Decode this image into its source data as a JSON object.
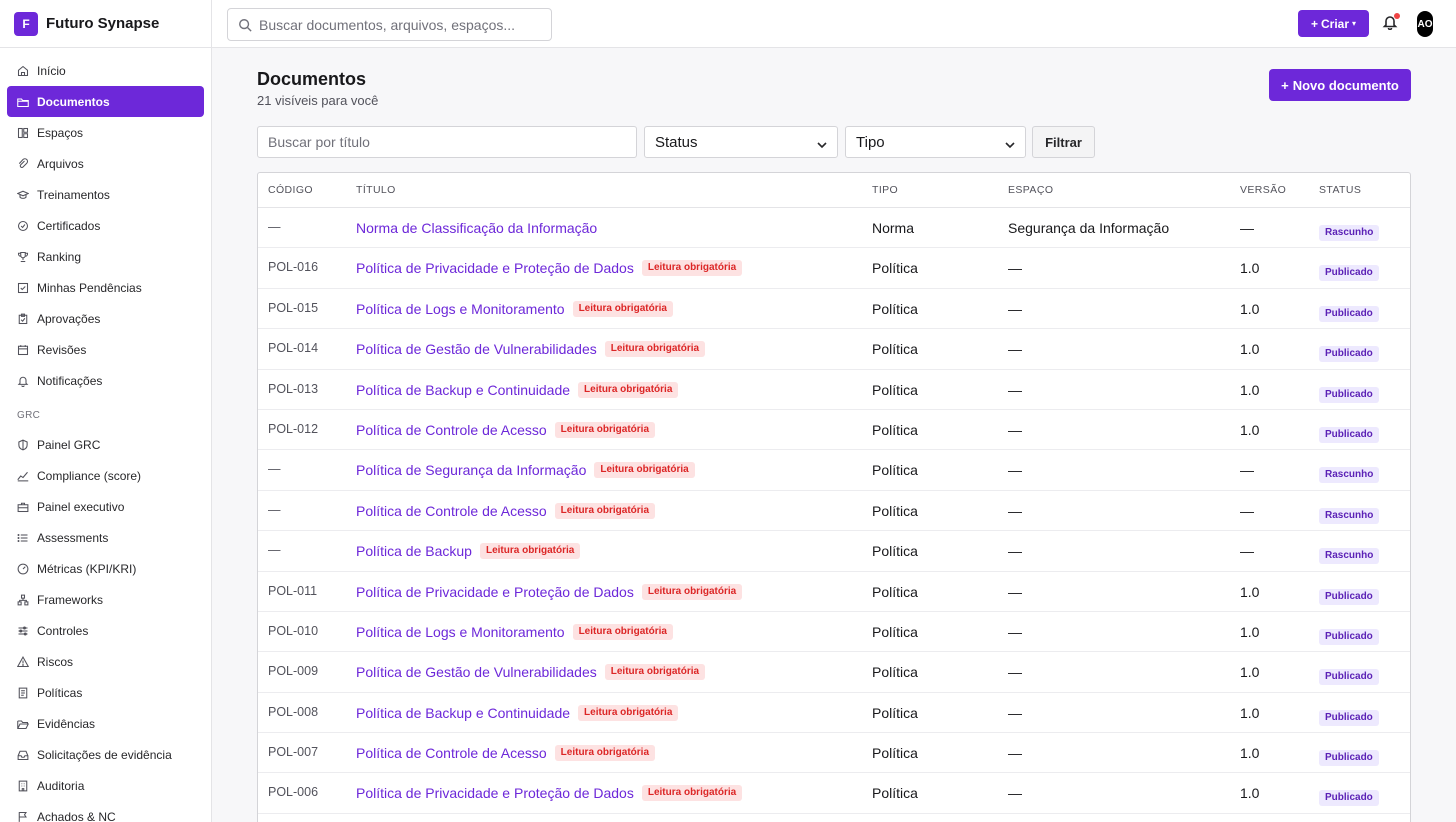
{
  "brand": {
    "logo_letter": "F",
    "name": "Futuro Synapse"
  },
  "sidebar": {
    "items": [
      {
        "label": "Início",
        "icon": "home-icon"
      },
      {
        "label": "Documentos",
        "icon": "folder-icon",
        "active": true
      },
      {
        "label": "Espaços",
        "icon": "spaces-icon"
      },
      {
        "label": "Arquivos",
        "icon": "paperclip-icon"
      },
      {
        "label": "Treinamentos",
        "icon": "graduation-icon"
      },
      {
        "label": "Certificados",
        "icon": "badge-check-icon"
      },
      {
        "label": "Ranking",
        "icon": "trophy-icon"
      },
      {
        "label": "Minhas Pendências",
        "icon": "check-square-icon"
      },
      {
        "label": "Aprovações",
        "icon": "clipboard-check-icon"
      },
      {
        "label": "Revisões",
        "icon": "calendar-icon"
      },
      {
        "label": "Notificações",
        "icon": "bell-icon"
      }
    ],
    "section_label": "GRC",
    "grc_items": [
      {
        "label": "Painel GRC",
        "icon": "shield-icon"
      },
      {
        "label": "Compliance (score)",
        "icon": "trend-icon"
      },
      {
        "label": "Painel executivo",
        "icon": "briefcase-icon"
      },
      {
        "label": "Assessments",
        "icon": "list-icon"
      },
      {
        "label": "Métricas (KPI/KRI)",
        "icon": "gauge-icon"
      },
      {
        "label": "Frameworks",
        "icon": "network-icon"
      },
      {
        "label": "Controles",
        "icon": "sliders-icon"
      },
      {
        "label": "Riscos",
        "icon": "warning-icon"
      },
      {
        "label": "Políticas",
        "icon": "document-icon"
      },
      {
        "label": "Evidências",
        "icon": "folder-open-icon"
      },
      {
        "label": "Solicitações de evidência",
        "icon": "inbox-icon"
      },
      {
        "label": "Auditoria",
        "icon": "building-icon"
      },
      {
        "label": "Achados & NC",
        "icon": "flag-icon"
      }
    ]
  },
  "topbar": {
    "search_placeholder": "Buscar documentos, arquivos, espaços...",
    "create_label": "Criar",
    "avatar_initials": "AO"
  },
  "page": {
    "title": "Documentos",
    "subtitle": "21 visíveis para você",
    "new_button": "Novo documento"
  },
  "filters": {
    "title_placeholder": "Buscar por título",
    "status_selected": "Status",
    "tipo_selected": "Tipo",
    "filter_button": "Filtrar"
  },
  "table": {
    "columns": [
      "CÓDIGO",
      "TÍTULO",
      "TIPO",
      "ESPAÇO",
      "VERSÃO",
      "STATUS"
    ],
    "required_badge": "Leitura obrigatória",
    "rows": [
      {
        "code": "—",
        "title": "Norma de Classificação da Informação",
        "required": false,
        "tipo": "Norma",
        "espaco": "Segurança da Informação",
        "versao": "—",
        "status": "Rascunho"
      },
      {
        "code": "POL-016",
        "title": "Política de Privacidade e Proteção de Dados",
        "required": true,
        "tipo": "Política",
        "espaco": "—",
        "versao": "1.0",
        "status": "Publicado"
      },
      {
        "code": "POL-015",
        "title": "Política de Logs e Monitoramento",
        "required": true,
        "tipo": "Política",
        "espaco": "—",
        "versao": "1.0",
        "status": "Publicado"
      },
      {
        "code": "POL-014",
        "title": "Política de Gestão de Vulnerabilidades",
        "required": true,
        "tipo": "Política",
        "espaco": "—",
        "versao": "1.0",
        "status": "Publicado"
      },
      {
        "code": "POL-013",
        "title": "Política de Backup e Continuidade",
        "required": true,
        "tipo": "Política",
        "espaco": "—",
        "versao": "1.0",
        "status": "Publicado"
      },
      {
        "code": "POL-012",
        "title": "Política de Controle de Acesso",
        "required": true,
        "tipo": "Política",
        "espaco": "—",
        "versao": "1.0",
        "status": "Publicado"
      },
      {
        "code": "—",
        "title": "Política de Segurança da Informação",
        "required": true,
        "tipo": "Política",
        "espaco": "—",
        "versao": "—",
        "status": "Rascunho"
      },
      {
        "code": "—",
        "title": "Política de Controle de Acesso",
        "required": true,
        "tipo": "Política",
        "espaco": "—",
        "versao": "—",
        "status": "Rascunho"
      },
      {
        "code": "—",
        "title": "Política de Backup",
        "required": true,
        "tipo": "Política",
        "espaco": "—",
        "versao": "—",
        "status": "Rascunho"
      },
      {
        "code": "POL-011",
        "title": "Política de Privacidade e Proteção de Dados",
        "required": true,
        "tipo": "Política",
        "espaco": "—",
        "versao": "1.0",
        "status": "Publicado"
      },
      {
        "code": "POL-010",
        "title": "Política de Logs e Monitoramento",
        "required": true,
        "tipo": "Política",
        "espaco": "—",
        "versao": "1.0",
        "status": "Publicado"
      },
      {
        "code": "POL-009",
        "title": "Política de Gestão de Vulnerabilidades",
        "required": true,
        "tipo": "Política",
        "espaco": "—",
        "versao": "1.0",
        "status": "Publicado"
      },
      {
        "code": "POL-008",
        "title": "Política de Backup e Continuidade",
        "required": true,
        "tipo": "Política",
        "espaco": "—",
        "versao": "1.0",
        "status": "Publicado"
      },
      {
        "code": "POL-007",
        "title": "Política de Controle de Acesso",
        "required": true,
        "tipo": "Política",
        "espaco": "—",
        "versao": "1.0",
        "status": "Publicado"
      },
      {
        "code": "POL-006",
        "title": "Política de Privacidade e Proteção de Dados",
        "required": true,
        "tipo": "Política",
        "espaco": "—",
        "versao": "1.0",
        "status": "Publicado"
      }
    ]
  },
  "colors": {
    "accent": "#6d28d9",
    "required_bg": "#fde2e2",
    "required_fg": "#dc2626",
    "status_bg": "#ede9fe",
    "status_fg": "#5b21b6"
  }
}
